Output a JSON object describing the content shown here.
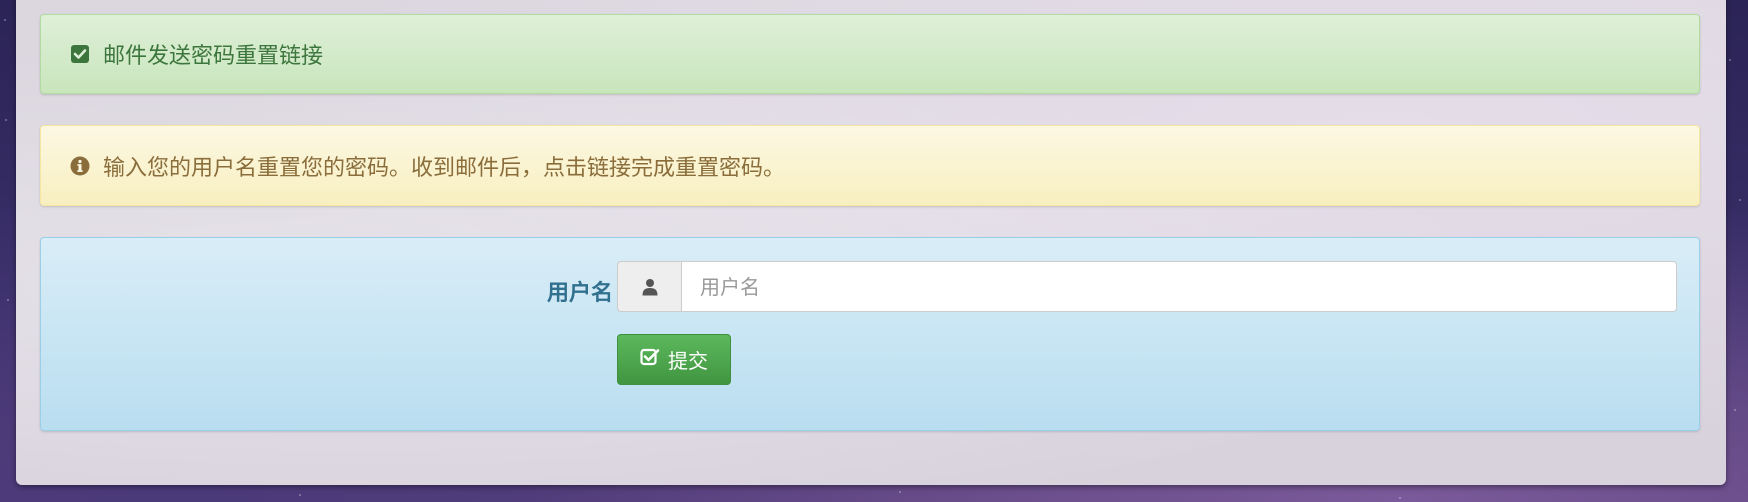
{
  "colors": {
    "success_text": "#3c763d",
    "warning_text": "#8a6d3b",
    "info_text": "#31708f",
    "button_bg": "#5cb85c"
  },
  "success_alert": {
    "icon": "check-square-icon",
    "text": "邮件发送密码重置链接"
  },
  "info_alert": {
    "icon": "info-circle-icon",
    "text": "输入您的用户名重置您的密码。收到邮件后，点击链接完成重置密码。"
  },
  "form": {
    "username_label": "用户名",
    "username_icon": "user-icon",
    "username_placeholder": "用户名",
    "username_value": "",
    "submit_icon": "check-square-o-icon",
    "submit_label": "提交"
  }
}
